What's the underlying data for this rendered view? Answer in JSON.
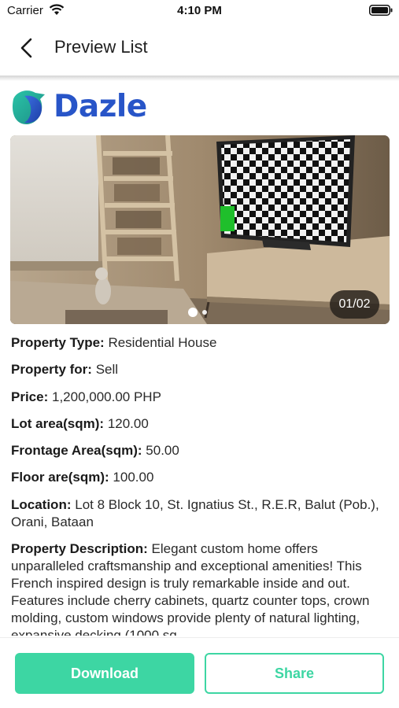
{
  "status_bar": {
    "carrier": "Carrier",
    "time": "4:10 PM"
  },
  "nav": {
    "title": "Preview List"
  },
  "brand": {
    "name": "Dazle",
    "color": "#2855c8"
  },
  "gallery": {
    "counter": "01/02",
    "current_index": 1,
    "total": 2
  },
  "details": [
    {
      "label": "Property Type:",
      "value": "Residential House"
    },
    {
      "label": "Property for:",
      "value": "Sell"
    },
    {
      "label": "Price:",
      "value": "1,200,000.00 PHP"
    },
    {
      "label": "Lot area(sqm):",
      "value": "120.00"
    },
    {
      "label": "Frontage Area(sqm):",
      "value": "50.00"
    },
    {
      "label": "Floor are(sqm):",
      "value": "100.00"
    },
    {
      "label": "Location:",
      "value": "Lot 8 Block 10, St. Ignatius St., R.E.R, Balut (Pob.), Orani, Bataan"
    },
    {
      "label": "Property Description:",
      "value": "Elegant custom home offers unparalleled craftsmanship and exceptional amenities! This French inspired design is truly remarkable inside and out. Features include cherry cabinets, quartz counter tops, crown molding, custom windows provide plenty of natural lighting, expansive decking (1000 sq."
    }
  ],
  "actions": {
    "download_label": "Download",
    "share_label": "Share"
  },
  "colors": {
    "accent": "#3dd6a3",
    "text": "#2a2a2a"
  },
  "icons": {
    "back": "chevron-left-icon",
    "wifi": "wifi-icon",
    "battery": "battery-icon",
    "logo": "dazle-logo-icon"
  }
}
